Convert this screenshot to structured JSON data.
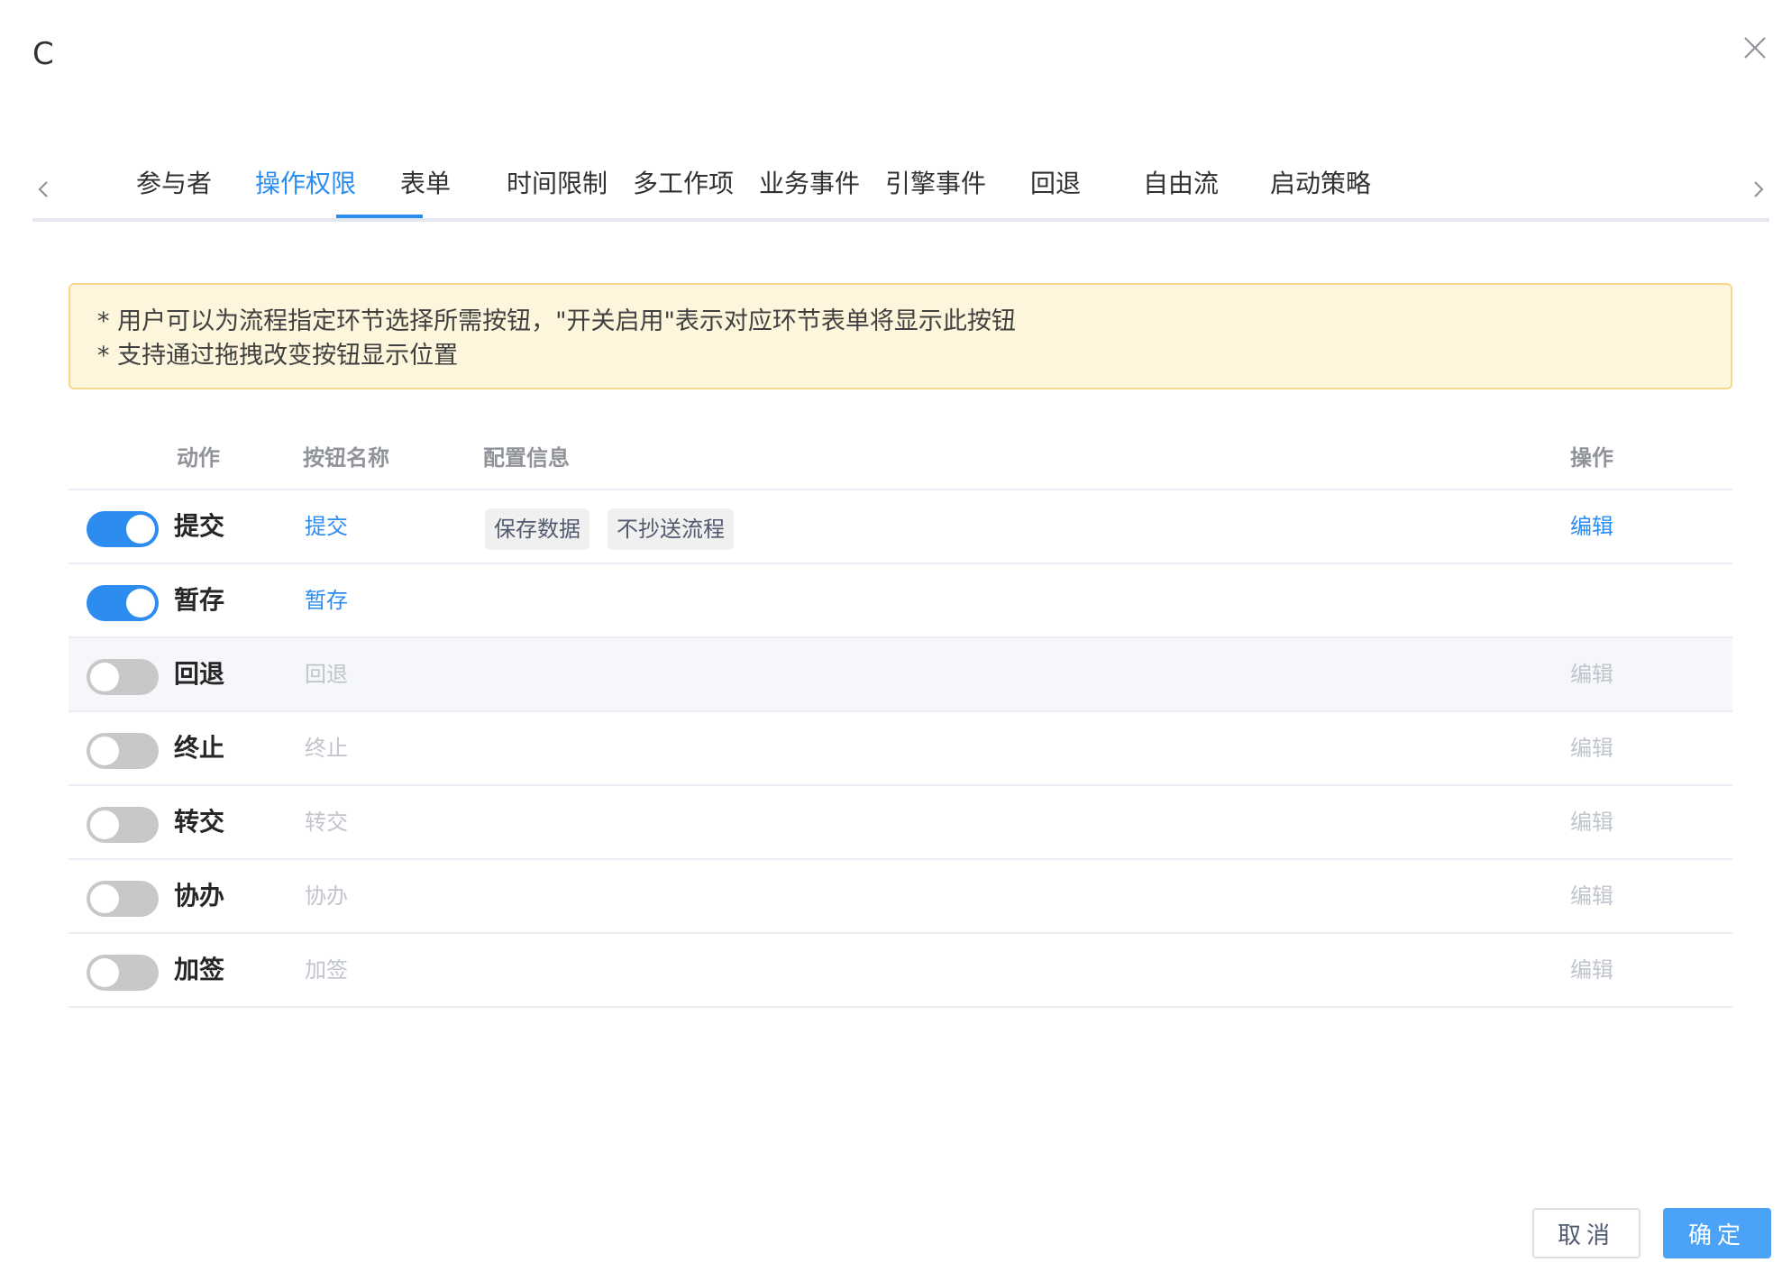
{
  "dialog": {
    "title": "C",
    "close_icon": "close-icon"
  },
  "tabs": {
    "prev_icon": "chevron-left-icon",
    "next_icon": "chevron-right-icon",
    "active_index": 1,
    "items": [
      {
        "label": "参与者"
      },
      {
        "label": "操作权限"
      },
      {
        "label": "表单"
      },
      {
        "label": "时间限制"
      },
      {
        "label": "多工作项"
      },
      {
        "label": "业务事件"
      },
      {
        "label": "引擎事件"
      },
      {
        "label": "回退"
      },
      {
        "label": "自由流"
      },
      {
        "label": "启动策略"
      }
    ]
  },
  "notice": {
    "lines": [
      "* 用户可以为流程指定环节选择所需按钮，\"开关启用\"表示对应环节表单将显示此按钮",
      "* 支持通过拖拽改变按钮显示位置"
    ]
  },
  "table": {
    "headers": {
      "action": "动作",
      "button_name": "按钮名称",
      "config": "配置信息",
      "operation": "操作"
    },
    "rows": [
      {
        "action": "提交",
        "button_name": "提交",
        "enabled": true,
        "tags": [
          "保存数据",
          "不抄送流程"
        ],
        "edit": "编辑"
      },
      {
        "action": "暂存",
        "button_name": "暂存",
        "enabled": true,
        "tags": [],
        "edit": ""
      },
      {
        "action": "回退",
        "button_name": "回退",
        "enabled": false,
        "tags": [],
        "edit": "编辑"
      },
      {
        "action": "终止",
        "button_name": "终止",
        "enabled": false,
        "tags": [],
        "edit": "编辑"
      },
      {
        "action": "转交",
        "button_name": "转交",
        "enabled": false,
        "tags": [],
        "edit": "编辑"
      },
      {
        "action": "协办",
        "button_name": "协办",
        "enabled": false,
        "tags": [],
        "edit": "编辑"
      },
      {
        "action": "加签",
        "button_name": "加签",
        "enabled": false,
        "tags": [],
        "edit": "编辑"
      }
    ]
  },
  "footer": {
    "cancel_label": "取消",
    "ok_label": "确定"
  },
  "colors": {
    "accent": "#2d8cf0",
    "switch_off": "#c8c8c8",
    "notice_bg": "#fdf6dc",
    "notice_border": "#f5d98a",
    "primary_button": "#4aa3f7"
  }
}
